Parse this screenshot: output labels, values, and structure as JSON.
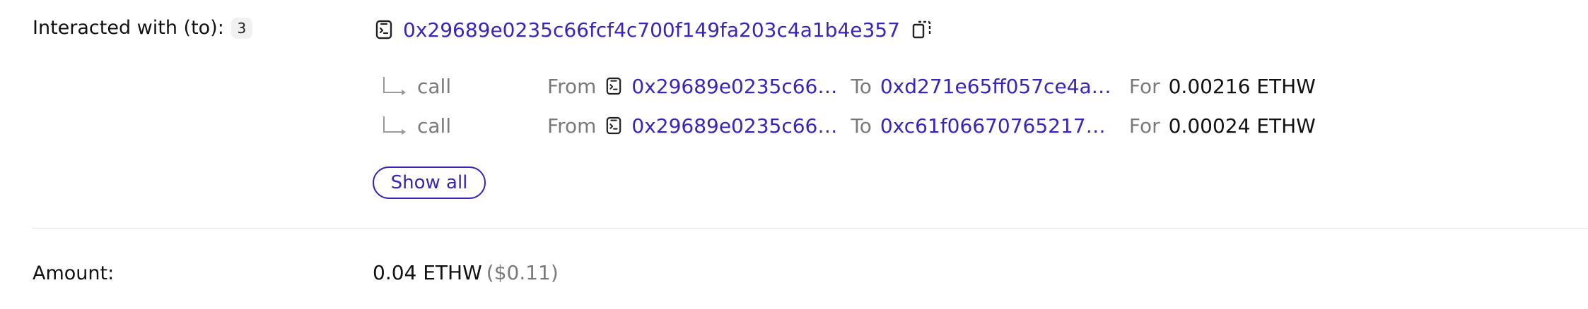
{
  "interacted": {
    "label": "Interacted with (to):",
    "count": "3",
    "contract_icon": "contract-icon",
    "address": "0x29689e0235c66fcf4c700f149fa203c4a1b4e357",
    "copy_icon": "copy-icon"
  },
  "calls": [
    {
      "type": "call",
      "from_label": "From",
      "from_address": "0x29689e0235c66fc…",
      "to_label": "To",
      "to_address": "0xd271e65ff057ce4ade…",
      "for_label": "For",
      "value": "0.00216 ETHW"
    },
    {
      "type": "call",
      "from_label": "From",
      "from_address": "0x29689e0235c66fc…",
      "to_label": "To",
      "to_address": "0xc61f0667076521761…",
      "for_label": "For",
      "value": "0.00024 ETHW"
    }
  ],
  "show_all_label": "Show all",
  "amount": {
    "label": "Amount:",
    "value": "0.04 ETHW",
    "usd": "($0.11)"
  },
  "colors": {
    "link": "#3b25b6",
    "muted": "#7a7a7a",
    "divider": "#e4e4e4"
  }
}
